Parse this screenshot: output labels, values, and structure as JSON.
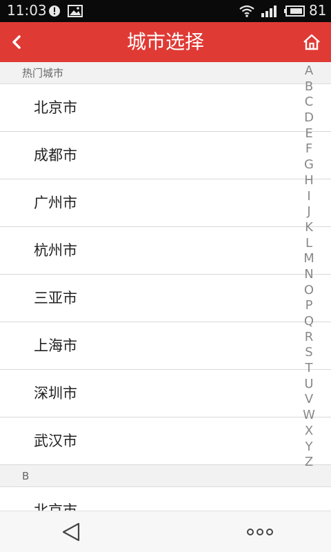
{
  "status_bar": {
    "time": "11:03",
    "battery": "81",
    "icons": [
      "alert-icon",
      "image-icon",
      "wifi-icon",
      "signal-icon",
      "battery-icon"
    ]
  },
  "header": {
    "title": "城市选择",
    "back_icon": "chevron-left-icon",
    "home_icon": "home-icon",
    "background": "#e03a35"
  },
  "sections": [
    {
      "label": "热门城市",
      "cities": [
        "北京市",
        "成都市",
        "广州市",
        "杭州市",
        "三亚市",
        "上海市",
        "深圳市",
        "武汉市"
      ]
    },
    {
      "label": "B",
      "cities": [
        "北京市"
      ]
    }
  ],
  "alphabet_index": [
    "A",
    "B",
    "C",
    "D",
    "E",
    "F",
    "G",
    "H",
    "I",
    "J",
    "K",
    "L",
    "M",
    "N",
    "O",
    "P",
    "Q",
    "R",
    "S",
    "T",
    "U",
    "V",
    "W",
    "X",
    "Y",
    "Z"
  ],
  "bottom_nav": {
    "icons": [
      "triangle-back-icon",
      "more-dots-icon"
    ]
  }
}
